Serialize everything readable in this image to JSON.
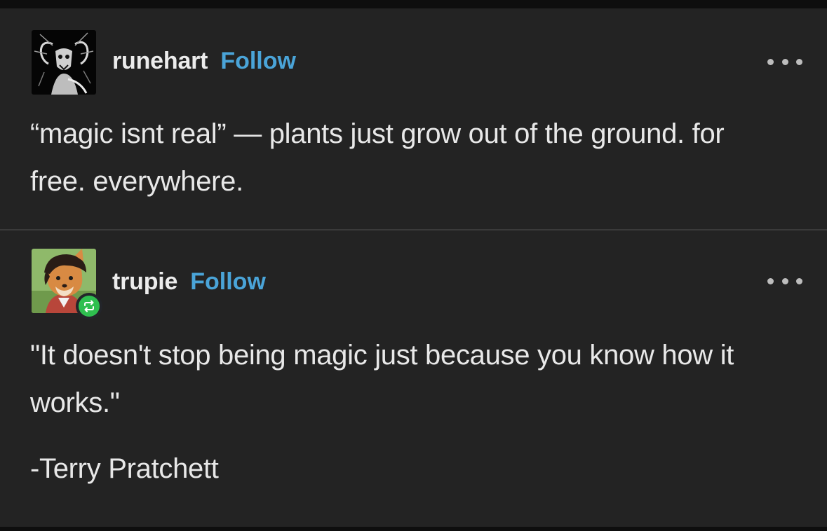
{
  "posts": [
    {
      "username": "runehart",
      "follow_label": "Follow",
      "text": "“magic isnt real” — plants just grow out of the ground. for free. everywhere.",
      "avatar_icon": "ram-skull-avatar",
      "more_icon": "more-options-icon"
    },
    {
      "username": "trupie",
      "follow_label": "Follow",
      "quote": "\"It doesn't stop being magic just because you know how it works.\"",
      "attribution": "-Terry Pratchett",
      "avatar_icon": "fox-character-avatar",
      "badge_icon": "reblog-icon",
      "more_icon": "more-options-icon"
    }
  ],
  "colors": {
    "background": "#232323",
    "follow_link": "#4aa4d8",
    "reblog_badge": "#2fbf4f",
    "divider": "#3a3a3a"
  }
}
